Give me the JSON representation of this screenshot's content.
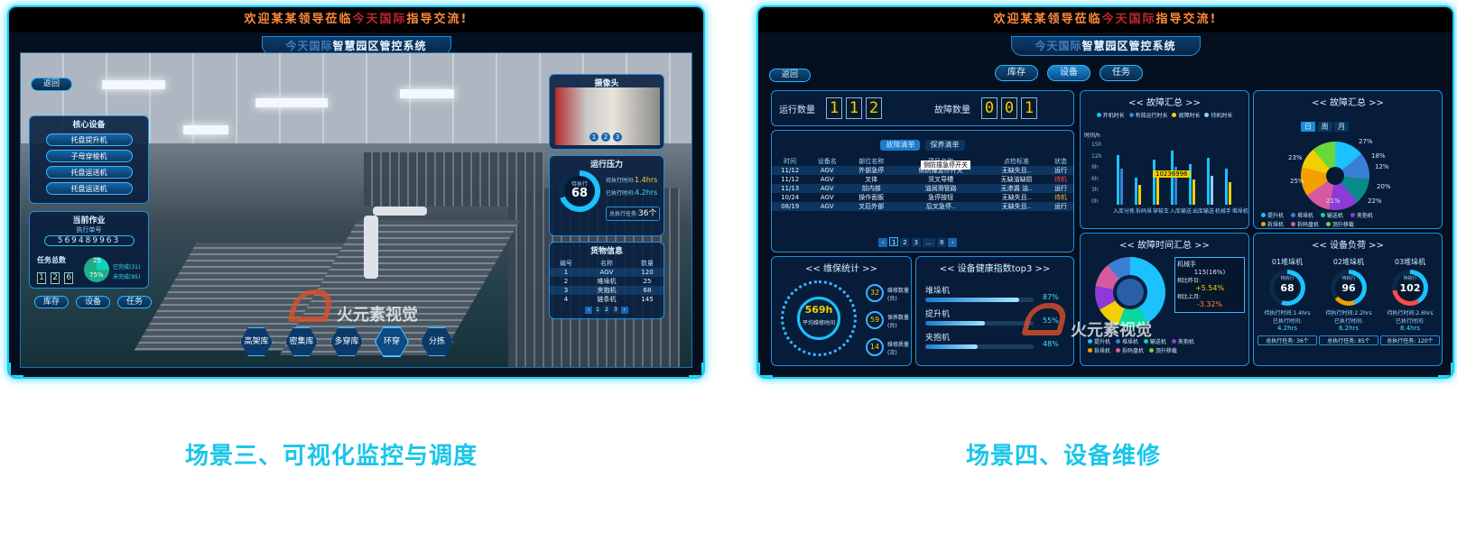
{
  "colors": {
    "accent": "#19d6ff",
    "caption": "#18c6ea",
    "banner_orange": "#ff8a3a",
    "digit_yellow": "#f2d000"
  },
  "left": {
    "banner": {
      "pre": "欢迎某某领导莅临",
      "mid": "今天国际",
      "post": "指导交流!"
    },
    "system": {
      "pre": "今天国际",
      "title": "智慧园区管控系统"
    },
    "back": "返回",
    "core": {
      "title": "核心设备",
      "items": [
        "托盘提升机",
        "子母穿梭机",
        "托盘运送机",
        "托盘运送机"
      ]
    },
    "job": {
      "title": "当前作业",
      "exec_label": "执行单号",
      "exec_no": "569489963",
      "total_label": "任务总数",
      "total_digits": [
        "1",
        "2",
        "6"
      ],
      "done_pct": "25",
      "remain_pct": "75%",
      "done": "已完成(31)",
      "remain": "未完成(95)"
    },
    "tabs": [
      "库存",
      "设备",
      "任务"
    ],
    "camera": {
      "title": "摄像头",
      "dots": [
        "1",
        "2",
        "3"
      ]
    },
    "pressure": {
      "title": "运行压力",
      "label": "待执行",
      "value": "68",
      "rows": [
        {
          "k": "待执行时间:",
          "v": "1.4hrs"
        },
        {
          "k": "已执行时间:",
          "v": "4.2hrs"
        }
      ],
      "total_k": "总执行任务:",
      "total_v": "36个"
    },
    "goods": {
      "title": "货物信息",
      "headers": [
        "编号",
        "名称",
        "数量"
      ],
      "rows": [
        [
          "1",
          "AGV",
          "120"
        ],
        [
          "2",
          "堆垛机",
          "25"
        ],
        [
          "3",
          "夹抱机",
          "68"
        ],
        [
          "4",
          "链条机",
          "145"
        ]
      ],
      "pages": [
        "1",
        "2",
        "3"
      ]
    },
    "hexes": [
      "高架库",
      "密集库",
      "多穿库",
      "环穿",
      "分拣"
    ],
    "watermark": "火元素视觉",
    "caption": "场景三、可视化监控与调度"
  },
  "right": {
    "banner": {
      "pre": "欢迎某某领导莅临",
      "mid": "今天国际",
      "post": "指导交流!"
    },
    "system": {
      "pre": "今天国际",
      "title": "智慧园区管控系统"
    },
    "back": "返回",
    "tabs": [
      "库存",
      "设备",
      "任务"
    ],
    "run_label": "运行数量",
    "run_digits": [
      "1",
      "1",
      "2"
    ],
    "fault_label": "故障数量",
    "fault_digits": [
      "0",
      "0",
      "1"
    ],
    "list_tabs": [
      "故障清单",
      "保养清单"
    ],
    "tooltip": "侧防撞急停开关",
    "table": {
      "headers": [
        "时间",
        "设备名",
        "部位名称",
        "项目名称",
        "点检标准",
        "状态"
      ],
      "rows": [
        [
          "11/12",
          "AGV",
          "外部急停",
          "侧防撞急停开关",
          "无缺失且..",
          "运行"
        ],
        [
          "11/12",
          "AGV",
          "叉体",
          "货叉导槽",
          "无缺油缺损",
          "待机"
        ],
        [
          "11/13",
          "AGV",
          "前内部",
          "油润滑管路",
          "无渗漏 油..",
          "运行"
        ],
        [
          "10/24",
          "AGV",
          "操作面板",
          "急停按钮",
          "无缺失且..",
          "待机"
        ],
        [
          "08/19",
          "AGV",
          "叉后外部",
          "后叉急停..",
          "无缺失且..",
          "运行"
        ]
      ]
    },
    "pager": [
      "1",
      "2",
      "3",
      "...",
      "8"
    ],
    "fault_sum": {
      "title": "故障汇总",
      "legend": [
        "开机时长",
        "有效运行时长",
        "故障时长",
        "待机时长"
      ],
      "unit": "时间/h",
      "yticks": [
        "15h",
        "12h",
        "9h",
        "6h",
        "3h",
        "0h"
      ],
      "cats": [
        "入库分拣",
        "拆码垛",
        "穿梭车",
        "入库输送",
        "出库输送",
        "机械手",
        "堆垛机"
      ],
      "tip": "10236996"
    },
    "fault_pie": {
      "title": "故障汇总",
      "periods": [
        "日",
        "周",
        "月"
      ],
      "pcts": [
        "27%",
        "18%",
        "12%",
        "20%",
        "22%",
        "21%",
        "25%",
        "23%"
      ],
      "legend": [
        "提升机",
        "堆垛机",
        "输送机",
        "夹抱机",
        "拆垛机",
        "拆码盘机",
        "顶升移载"
      ]
    },
    "maint": {
      "title": "维保统计",
      "center_v": "569h",
      "center_l": "平均维修时间",
      "items": [
        {
          "v": "32",
          "l": "维修数量(台)"
        },
        {
          "v": "59",
          "l": "保养数量(台)"
        },
        {
          "v": "14",
          "l": "维修质量(次)"
        }
      ]
    },
    "health": {
      "title": "设备健康指数top3",
      "items": [
        {
          "n": "堆垛机",
          "v": "87%",
          "f": 0.87
        },
        {
          "n": "提升机",
          "v": "55%",
          "f": 0.55
        },
        {
          "n": "夹抱机",
          "v": "48%",
          "f": 0.48
        }
      ]
    },
    "fault_time": {
      "title": "故障时间汇总",
      "name": "机械手",
      "val": "115(16%)",
      "yoy_l": "相比昨日:",
      "yoy": "+5.54%",
      "mom_l": "相比上月:",
      "mom": "-3.32%",
      "legend": [
        "提升机",
        "堆垛机",
        "输送机",
        "夹抱机",
        "拆垛机",
        "拆码盘机",
        "顶升移载"
      ]
    },
    "load": {
      "title": "设备负荷",
      "machines": [
        {
          "n": "01堆垛机",
          "v": "68",
          "t1": "待执行时间:1.4hrs",
          "t2": "已执行时间:",
          "t3": "4.2hrs",
          "tot": "总执行任务: 36个"
        },
        {
          "n": "02堆垛机",
          "v": "96",
          "t1": "待执行时间:2.2hrs",
          "t2": "已执行时间:",
          "t3": "6.2hrs",
          "tot": "总执行任务: 85个"
        },
        {
          "n": "03堆垛机",
          "v": "102",
          "t1": "待执行时间:2.6hrs",
          "t2": "已执行时间:",
          "t3": "8.4hrs",
          "tot": "总执行任务: 120个"
        }
      ],
      "ring_label": "待执行"
    },
    "watermark": "火元素视觉",
    "caption": "场景四、设备维修"
  }
}
